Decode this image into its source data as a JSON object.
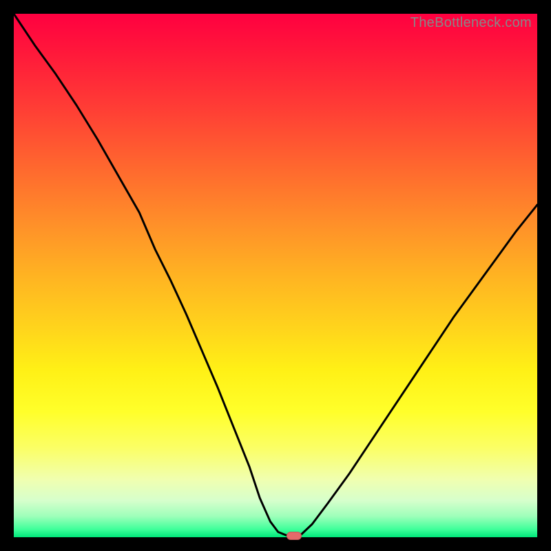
{
  "watermark": "TheBottleneck.com",
  "marker": {
    "x_pct": 53.5,
    "y_pct": 0
  },
  "chart_data": {
    "type": "line",
    "title": "",
    "xlabel": "",
    "ylabel": "",
    "xlim": [
      0,
      100
    ],
    "ylim": [
      0,
      100
    ],
    "note": "Axes are unlabeled in the image; values are normalized 0–100 percent estimates read from pixel positions (x left→right, y bottom→top).",
    "series": [
      {
        "name": "bottleneck-curve",
        "x": [
          0,
          4,
          8,
          12,
          16,
          20,
          24,
          27,
          30,
          33,
          36,
          39,
          42,
          45,
          47,
          49,
          50.5,
          52,
          54,
          55,
          57,
          60,
          64,
          68,
          72,
          76,
          80,
          84,
          88,
          92,
          96,
          100
        ],
        "y": [
          100,
          94,
          88.5,
          82.5,
          76,
          69,
          62,
          55,
          49,
          42.5,
          35.5,
          28.5,
          21,
          13.5,
          7.5,
          3,
          1,
          0.4,
          0.3,
          0.6,
          2.5,
          6.5,
          12,
          18,
          24,
          30,
          36,
          42,
          47.5,
          53,
          58.5,
          63.5
        ]
      }
    ],
    "annotations": [
      {
        "name": "optimal-marker",
        "x": 53.5,
        "y": 0,
        "shape": "pill",
        "color": "#e46a6a"
      }
    ],
    "background_gradient": {
      "direction": "vertical",
      "stops": [
        {
          "pos": 0.0,
          "color": "#ff0040"
        },
        {
          "pos": 0.5,
          "color": "#ffb322"
        },
        {
          "pos": 0.76,
          "color": "#ffff2a"
        },
        {
          "pos": 1.0,
          "color": "#00e67a"
        }
      ]
    }
  }
}
